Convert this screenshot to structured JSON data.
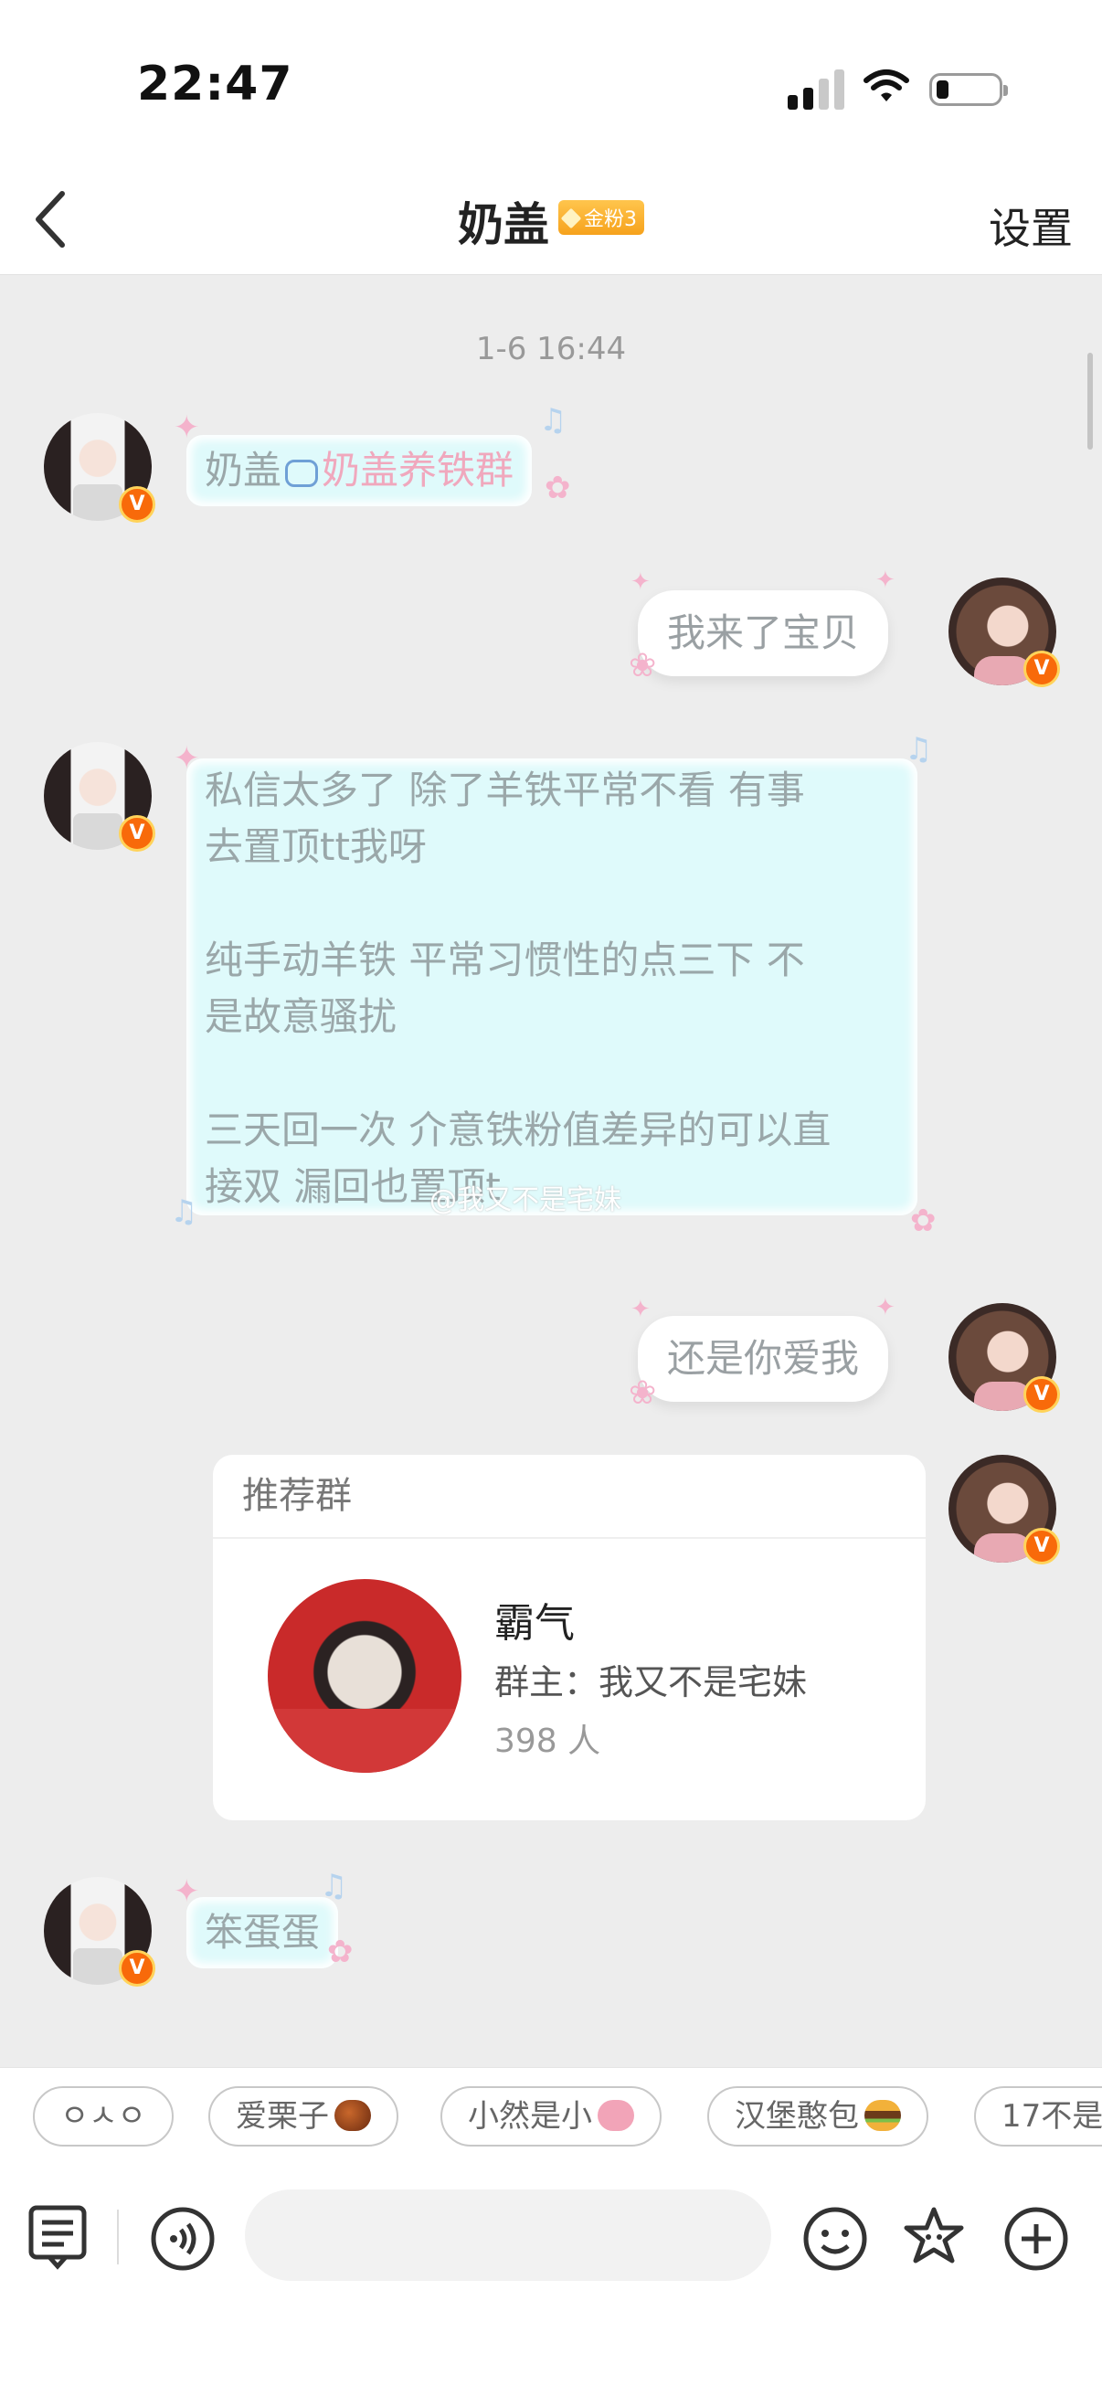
{
  "status_bar": {
    "time": "22:47"
  },
  "nav": {
    "title": "奶盖",
    "fan_badge": "金粉3",
    "settings": "设置"
  },
  "chat": {
    "timestamp": "1-6 16:44",
    "messages": [
      {
        "from": "them",
        "prefix": "奶盖",
        "group_link": "奶盖养铁群"
      },
      {
        "from": "me",
        "text": "我来了宝贝"
      },
      {
        "from": "them",
        "lines": [
          "私信太多了 除了羊铁平常不看  有事",
          "去置顶tt我呀",
          "",
          "纯手动羊铁 平常习惯性的点三下 不",
          "是故意骚扰",
          "",
          "三天回一次 介意铁粉值差异的可以直",
          "接双  漏回也置顶t"
        ]
      },
      {
        "from": "me",
        "text": "还是你爱我"
      },
      {
        "from": "me",
        "card": {
          "header": "推荐群",
          "name": "霸气",
          "owner": "群主：我又不是宅妹",
          "members": "398 人"
        }
      },
      {
        "from": "them",
        "text": "笨蛋蛋"
      }
    ],
    "watermark": "@我又不是宅妹",
    "verified_badge": "V"
  },
  "quick_replies": [
    "ㅇㅅㅇ",
    "爱栗子",
    "小然是小",
    "汉堡憨包",
    "17不是"
  ],
  "input": {
    "placeholder": ""
  }
}
